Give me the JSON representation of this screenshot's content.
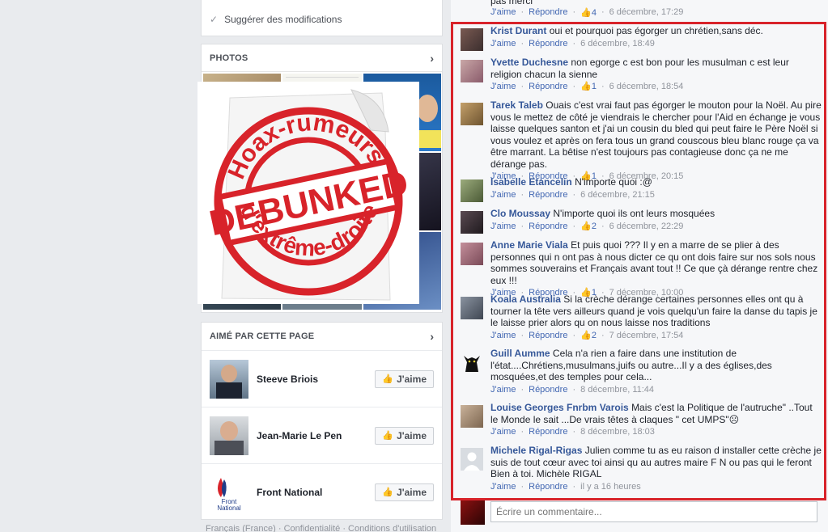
{
  "suggest": {
    "label": "Suggérer des modifications"
  },
  "photos": {
    "title": "PHOTOS"
  },
  "stamp": {
    "top_text": "Hoax-rumeurs",
    "center_text": "DEBUNKED",
    "bottom_text": "d'extrême-droite"
  },
  "liked": {
    "title": "AIMÉ PAR CETTE PAGE",
    "like_label": "J'aime",
    "pages": [
      {
        "name": "Steeve Briois"
      },
      {
        "name": "Jean-Marie Le Pen"
      },
      {
        "name": "Front National"
      }
    ]
  },
  "footer": {
    "text": "Français (France) · Confidentialité · Conditions d'utilisation"
  },
  "top_comment": {
    "text": "pas merci",
    "like": "J'aime",
    "reply": "Répondre",
    "likes": "4",
    "time": "6 décembre, 17:29"
  },
  "comment_actions": {
    "like": "J'aime",
    "reply": "Répondre",
    "sep": "·"
  },
  "comments": [
    {
      "name": "Krist Durant",
      "text": "oui et pourquoi pas égorger un chrétien,sans déc.",
      "likes": "",
      "time": "6 décembre, 18:49"
    },
    {
      "name": "Yvette Duchesne",
      "text": "non egorge c est bon pour les musulman c est leur religion chacun la sienne",
      "likes": "1",
      "time": "6 décembre, 18:54"
    },
    {
      "name": "Tarek Taleb",
      "text": "Ouais c'est vrai faut pas égorger le mouton pour la Noël. Au pire vous le mettez de côté je viendrais le chercher pour l'Aid en échange je vous laisse quelques santon et j'ai un cousin du bled qui peut faire le Père Noël si vous voulez et après on fera tous un grand couscous bleu blanc rouge ça va être marrant. La bêtise n'est toujours pas contagieuse donc ça ne me dérange pas.",
      "likes": "1",
      "time": "6 décembre, 20:15"
    },
    {
      "name": "Isabelle Etancelin",
      "text": "N'importe quoi :@",
      "likes": "",
      "time": "6 décembre, 21:15"
    },
    {
      "name": "Clo Moussay",
      "text": "N'importe quoi ils ont leurs mosquées",
      "likes": "2",
      "time": "6 décembre, 22:29"
    },
    {
      "name": "Anne Marie Viala",
      "text": "Et puis quoi ??? Il y en a marre de se plier à des personnes qui n ont pas à nous dicter ce qu ont dois faire sur nos sols nous sommes souverains et Français avant tout !! Ce que çà dérange rentre chez eux !!!",
      "likes": "1",
      "time": "7 décembre, 10:00"
    },
    {
      "name": "Koala Australia",
      "text": "Si la crèche dérange certaines personnes elles ont qu à tourner la tête vers ailleurs quand je vois quelqu'un faire la danse du tapis je le laisse prier alors qu on nous laisse nos traditions",
      "likes": "2",
      "time": "7 décembre, 17:54"
    },
    {
      "name": "Guill Aumme",
      "text": "Cela n'a rien a faire dans une institution de l'état....Chrétiens,musulmans,juifs ou autre...Il y a des églises,des mosquées,et des temples pour cela...",
      "likes": "",
      "time": "8 décembre, 11:44"
    },
    {
      "name": "Louise Georges Fnrbm Varois",
      "text": "Mais c'est la Politique de l'autruche\" ..Tout le Monde le sait ...De vrais têtes à claques \" cet UMPS\"☹",
      "likes": "",
      "time": "8 décembre, 18:03"
    },
    {
      "name": "Michele Rigal-Rigas",
      "text": "Julien comme tu as eu raison d installer cette crèche je suis de tout cœur avec toi ainsi qu au autres maire F N ou pas qui le feront Bien à toi. Michèle RIGAL",
      "likes": "",
      "time": "il y a 16 heures"
    }
  ],
  "write_comment": {
    "placeholder": "Écrire un commentaire..."
  },
  "colors": {
    "highlight_border": "#d8232a",
    "link": "#365899",
    "stamp_red": "#d8232a"
  }
}
